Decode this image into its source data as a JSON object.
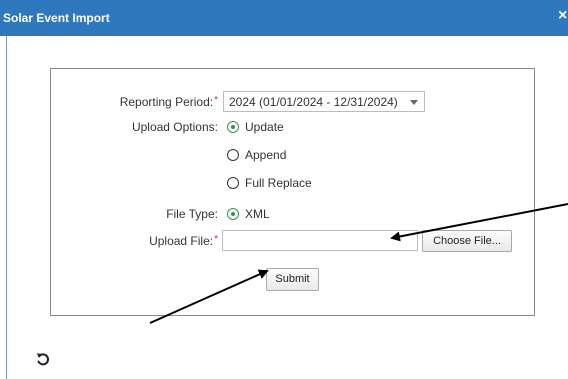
{
  "dialog": {
    "title": "Solar Event Import",
    "close_label": "×"
  },
  "form": {
    "reporting_period": {
      "label": "Reporting Period:",
      "required_mark": "*",
      "selected": "2024 (01/01/2024 - 12/31/2024)"
    },
    "upload_options": {
      "label": "Upload Options:",
      "options": [
        {
          "label": "Update",
          "checked": true
        },
        {
          "label": "Append",
          "checked": false
        },
        {
          "label": "Full Replace",
          "checked": false
        }
      ]
    },
    "file_type": {
      "label": "File Type:",
      "options": [
        {
          "label": "XML",
          "checked": true
        }
      ]
    },
    "upload_file": {
      "label": "Upload File:",
      "required_mark": "*",
      "value": "",
      "choose_label": "Choose File..."
    },
    "submit_label": "Submit"
  },
  "footer": {
    "reset_icon": "undo-icon"
  },
  "colors": {
    "titlebar": "#2f78be",
    "radio_checked": "#2e9a47",
    "required": "#d9312b"
  }
}
